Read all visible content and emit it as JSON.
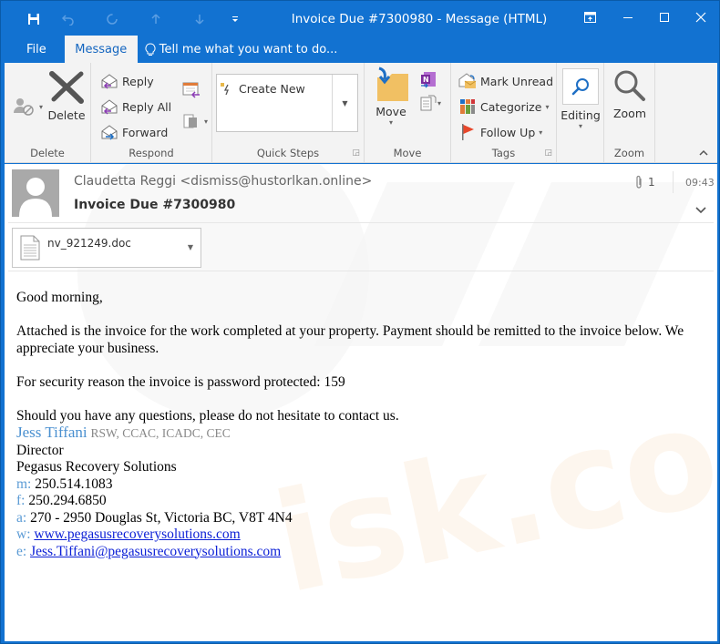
{
  "window": {
    "title": "Invoice Due #7300980  -  Message (HTML)",
    "controls": [
      "ribbon-display-options",
      "minimize",
      "maximize",
      "close"
    ]
  },
  "quick_access": {
    "save": "save-icon",
    "undo": "undo-icon",
    "redo": "redo-icon",
    "previous": "up-arrow-icon",
    "next": "down-arrow-icon",
    "customize": "customize-icon"
  },
  "tabs": {
    "file": "File",
    "message": "Message",
    "tell_me": "Tell me what you want to do..."
  },
  "ribbon": {
    "delete_group": {
      "label": "Delete",
      "delete": "Delete"
    },
    "respond_group": {
      "label": "Respond",
      "reply": "Reply",
      "reply_all": "Reply All",
      "forward": "Forward"
    },
    "quick_steps_group": {
      "label": "Quick Steps",
      "create_new": "Create New"
    },
    "move_group": {
      "label": "Move",
      "move": "Move"
    },
    "tags_group": {
      "label": "Tags",
      "mark_unread": "Mark Unread",
      "categorize": "Categorize",
      "follow_up": "Follow Up"
    },
    "editing": {
      "label": "Editing"
    },
    "zoom_group": {
      "label": "Zoom",
      "zoom": "Zoom"
    }
  },
  "message": {
    "from": "Claudetta Reggi <dismiss@hustorlkan.online>",
    "subject": "Invoice Due #7300980",
    "attachment_count": "1",
    "time": "09:43",
    "attachment": {
      "filename": "nv_921249.doc"
    },
    "body": {
      "greeting": "Good morning,",
      "para1": "Attached is the invoice for the work completed at your property. Payment should be remitted to the invoice below. We appreciate your business.",
      "para2": "For security reason the invoice is password protected: 159",
      "para3": "Should you have any questions, please do not hesitate to contact us."
    },
    "signature": {
      "name": "Jess Tiffani",
      "credentials": "RSW, CCAC, ICADC, CEC",
      "title": "Director",
      "company": "Pegasus Recovery Solutions",
      "mobile_label": "m:",
      "mobile": "250.514.1083",
      "fax_label": "f:",
      "fax": "250.294.6850",
      "address_label": "a:",
      "address": "270 - 2950 Douglas St, Victoria BC, V8T 4N4",
      "web_label": "w:",
      "web": "www.pegasusrecoverysolutions.com",
      "email_label": "e:",
      "email": "Jess.Tiffani@pegasusrecoverysolutions.com"
    }
  },
  "colors": {
    "titlebar": "#1272d1",
    "ribbon": "#f3f3f3",
    "active_tab_text": "#1466c0",
    "signature_name": "#4a90d0",
    "link": "#0b1fd6"
  }
}
